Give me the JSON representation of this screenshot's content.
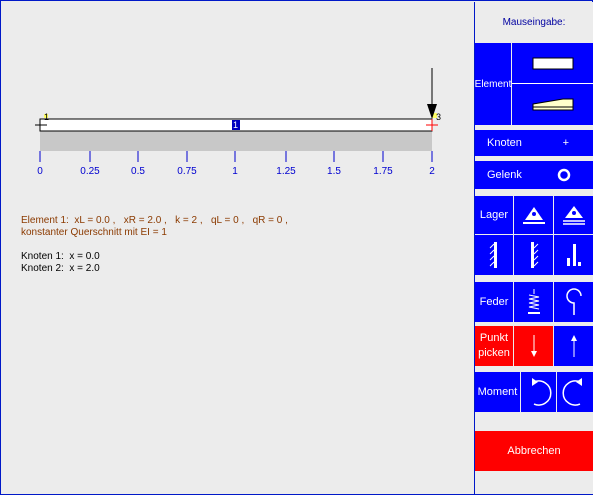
{
  "panel": {
    "title": "Mauseingabe:",
    "element_label": "Element",
    "knoten_label": "Knoten",
    "knoten_symbol": "+",
    "gelenk_label": "Gelenk",
    "lager_label": "Lager",
    "feder_label": "Feder",
    "punkt_label_1": "Punkt",
    "punkt_label_2": "picken",
    "moment_label": "Moment",
    "abbrechen_label": "Abbrechen",
    "colors": {
      "button": "#0000ff",
      "active": "#ff0000",
      "cancel": "#ff0000"
    }
  },
  "beam": {
    "node_left_label": "1",
    "node_right_label": "3",
    "element_label": "1",
    "ticks": [
      "0",
      "0.25",
      "0.5",
      "0.75",
      "1",
      "1.25",
      "1.5",
      "1.75",
      "2"
    ]
  },
  "info": {
    "element_line": "Element 1:  xL = 0.0 ,   xR = 2.0 ,   k = 2 ,   qL = 0 ,   qR = 0 ,",
    "element_line2": "konstanter Querschnitt mit EI = 1",
    "knoten1": "Knoten 1:  x = 0.0",
    "knoten2": "Knoten 2:  x = 2.0",
    "colors": {
      "element_text": "#8b3a00",
      "knoten_text": "#000000"
    }
  }
}
